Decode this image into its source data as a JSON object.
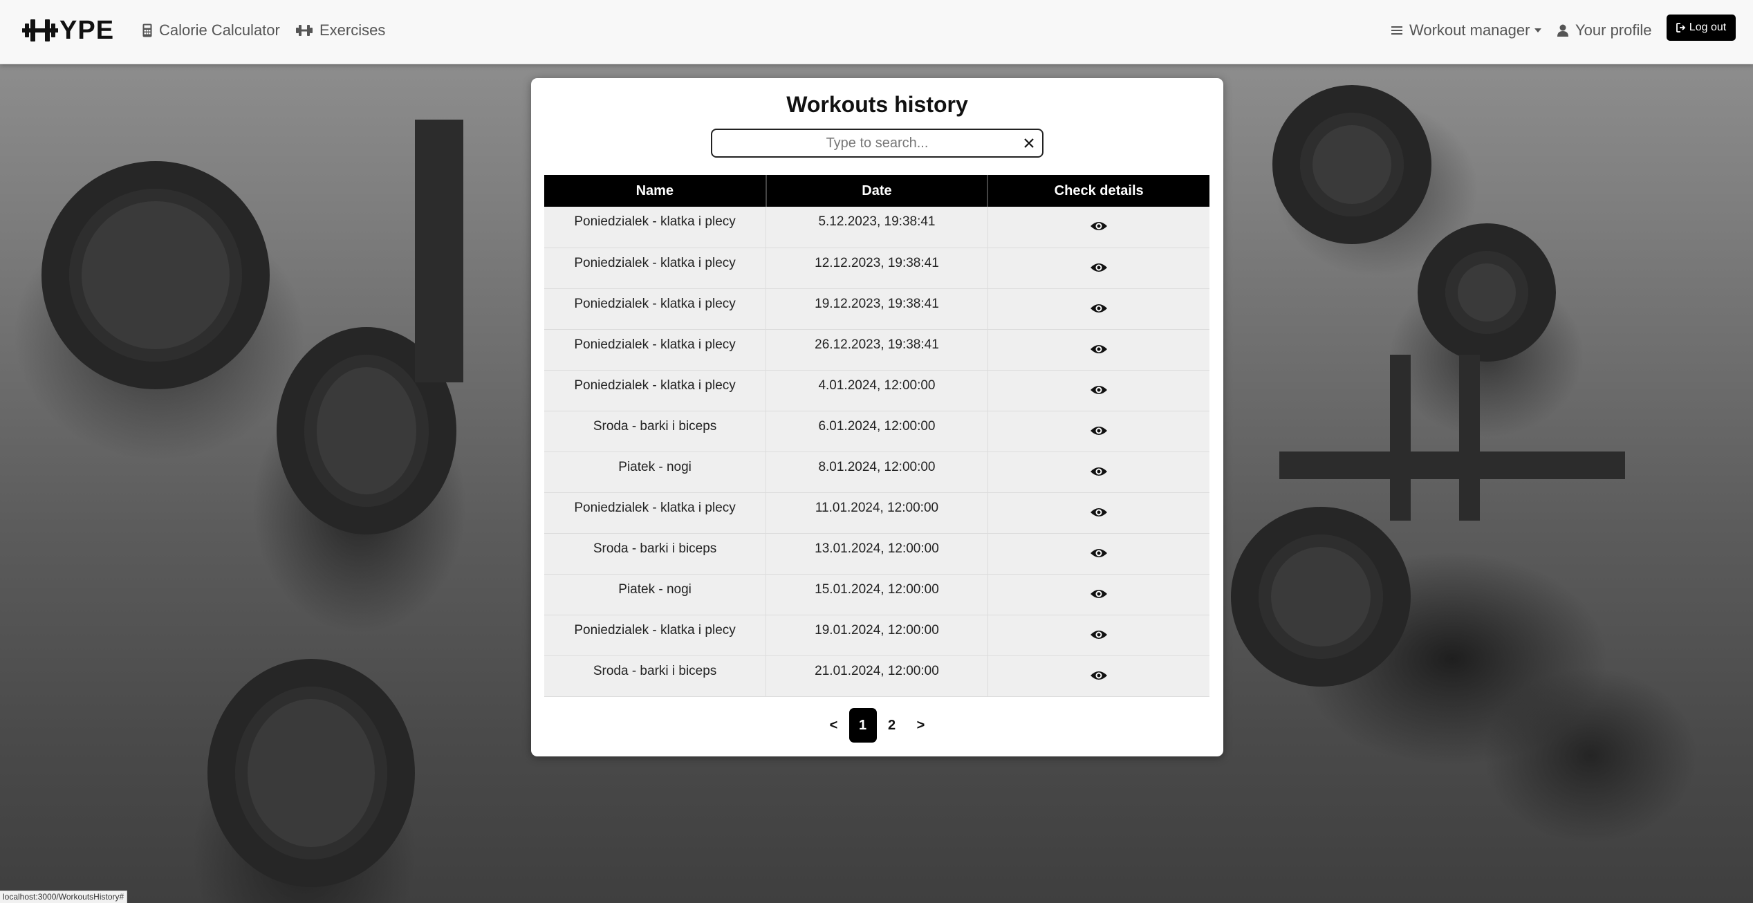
{
  "brand": {
    "text": "YPE",
    "icon": "dumbbell-icon"
  },
  "nav": {
    "calorie_calculator": "Calorie Calculator",
    "exercises": "Exercises",
    "workout_manager": "Workout manager",
    "your_profile": "Your profile",
    "log_out": "Log out"
  },
  "card": {
    "title": "Workouts history",
    "search_placeholder": "Type to search...",
    "clear_label": "X"
  },
  "table": {
    "headers": [
      "Name",
      "Date",
      "Check details"
    ],
    "rows": [
      {
        "name": "Poniedzialek - klatka i plecy",
        "date": "5.12.2023, 19:38:41"
      },
      {
        "name": "Poniedzialek - klatka i plecy",
        "date": "12.12.2023, 19:38:41"
      },
      {
        "name": "Poniedzialek - klatka i plecy",
        "date": "19.12.2023, 19:38:41"
      },
      {
        "name": "Poniedzialek - klatka i plecy",
        "date": "26.12.2023, 19:38:41"
      },
      {
        "name": "Poniedzialek - klatka i plecy",
        "date": "4.01.2024, 12:00:00"
      },
      {
        "name": "Sroda - barki i biceps",
        "date": "6.01.2024, 12:00:00"
      },
      {
        "name": "Piatek - nogi",
        "date": "8.01.2024, 12:00:00"
      },
      {
        "name": "Poniedzialek - klatka i plecy",
        "date": "11.01.2024, 12:00:00"
      },
      {
        "name": "Sroda - barki i biceps",
        "date": "13.01.2024, 12:00:00"
      },
      {
        "name": "Piatek - nogi",
        "date": "15.01.2024, 12:00:00"
      },
      {
        "name": "Poniedzialek - klatka i plecy",
        "date": "19.01.2024, 12:00:00"
      },
      {
        "name": "Sroda - barki i biceps",
        "date": "21.01.2024, 12:00:00"
      }
    ]
  },
  "pagination": {
    "prev": "<",
    "pages": [
      "1",
      "2"
    ],
    "active": "1",
    "next": ">"
  },
  "status_bar": {
    "url": "localhost:3000/WorkoutsHistory#"
  },
  "colors": {
    "accent": "#000000",
    "navbar_bg": "#f8f8f8",
    "row_bg": "#efefef"
  }
}
